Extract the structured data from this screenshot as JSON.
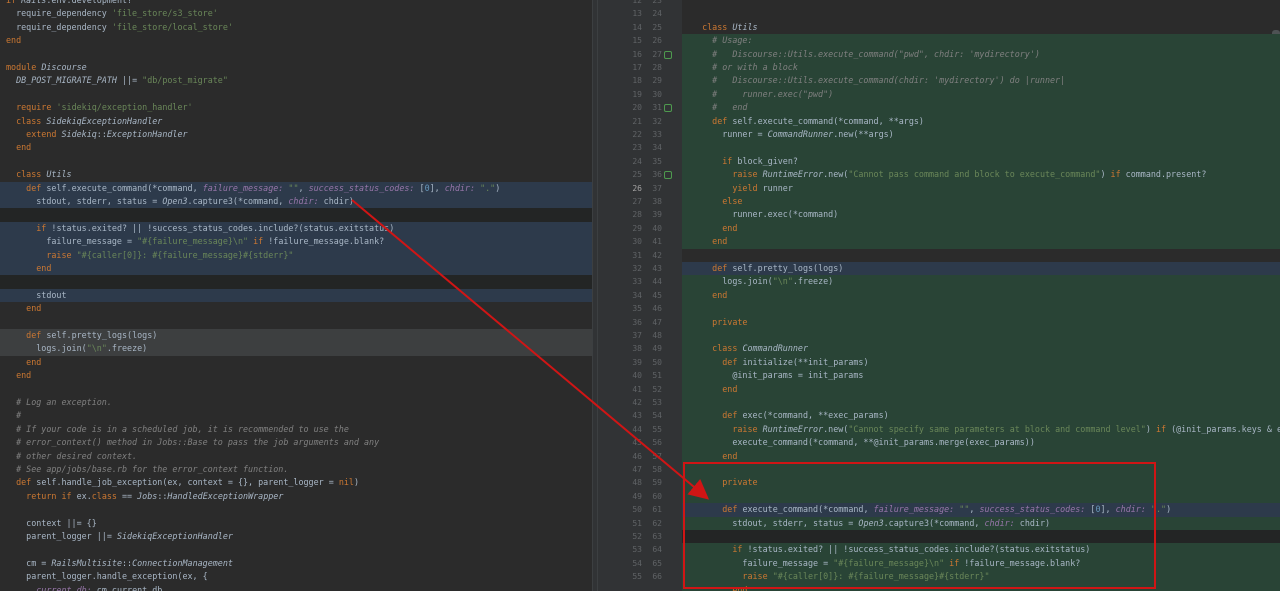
{
  "left_pane": {
    "lines": [
      {
        "t": "if Rails.env.development?",
        "cls": ""
      },
      {
        "t": "  require_dependency 'file_store/s3_store'",
        "cls": ""
      },
      {
        "t": "  require_dependency 'file_store/local_store'",
        "cls": ""
      },
      {
        "t": "end",
        "cls": ""
      },
      {
        "t": "",
        "cls": ""
      },
      {
        "t": "module Discourse",
        "cls": ""
      },
      {
        "t": "  DB_POST_MIGRATE_PATH ||= \"db/post_migrate\"",
        "cls": ""
      },
      {
        "t": "",
        "cls": ""
      },
      {
        "t": "  require 'sidekiq/exception_handler'",
        "cls": ""
      },
      {
        "t": "  class SidekiqExceptionHandler",
        "cls": ""
      },
      {
        "t": "    extend Sidekiq::ExceptionHandler",
        "cls": ""
      },
      {
        "t": "  end",
        "cls": ""
      },
      {
        "t": "",
        "cls": ""
      },
      {
        "t": "  class Utils",
        "cls": ""
      },
      {
        "t": "    def self.execute_command(*command, failure_message: \"\", success_status_codes: [0], chdir: \".\")",
        "cls": "hl-blue"
      },
      {
        "t": "      stdout, stderr, status = Open3.capture3(*command, chdir: chdir)",
        "cls": "hl-blue"
      },
      {
        "t": "",
        "cls": "hl-dark"
      },
      {
        "t": "      if !status.exited? || !success_status_codes.include?(status.exitstatus)",
        "cls": "hl-blue"
      },
      {
        "t": "        failure_message = \"#{failure_message}\\n\" if !failure_message.blank?",
        "cls": "hl-blue"
      },
      {
        "t": "        raise \"#{caller[0]}: #{failure_message}#{stderr}\"",
        "cls": "hl-blue"
      },
      {
        "t": "      end",
        "cls": "hl-blue"
      },
      {
        "t": "",
        "cls": "hl-dark"
      },
      {
        "t": "      stdout",
        "cls": "hl-blue"
      },
      {
        "t": "    end",
        "cls": ""
      },
      {
        "t": "",
        "cls": ""
      },
      {
        "t": "    def self.pretty_logs(logs)",
        "cls": "hl-grey"
      },
      {
        "t": "      logs.join(\"\\n\".freeze)",
        "cls": "hl-grey"
      },
      {
        "t": "    end",
        "cls": ""
      },
      {
        "t": "  end",
        "cls": ""
      },
      {
        "t": "",
        "cls": ""
      },
      {
        "t": "  # Log an exception.",
        "cls": ""
      },
      {
        "t": "  #",
        "cls": ""
      },
      {
        "t": "  # If your code is in a scheduled job, it is recommended to use the",
        "cls": ""
      },
      {
        "t": "  # error_context() method in Jobs::Base to pass the job arguments and any",
        "cls": ""
      },
      {
        "t": "  # other desired context.",
        "cls": ""
      },
      {
        "t": "  # See app/jobs/base.rb for the error_context function.",
        "cls": ""
      },
      {
        "t": "  def self.handle_job_exception(ex, context = {}, parent_logger = nil)",
        "cls": ""
      },
      {
        "t": "    return if ex.class == Jobs::HandledExceptionWrapper",
        "cls": ""
      },
      {
        "t": "",
        "cls": ""
      },
      {
        "t": "    context ||= {}",
        "cls": ""
      },
      {
        "t": "    parent_logger ||= SidekiqExceptionHandler",
        "cls": ""
      },
      {
        "t": "",
        "cls": ""
      },
      {
        "t": "    cm = RailsMultisite::ConnectionManagement",
        "cls": ""
      },
      {
        "t": "    parent_logger.handle_exception(ex, {",
        "cls": ""
      },
      {
        "t": "      current_db: cm.current_db,",
        "cls": ""
      }
    ]
  },
  "gutter": {
    "numbers": [
      "12",
      "13",
      "14",
      "15",
      "16",
      "17",
      "18",
      "19",
      "20",
      "21",
      "22",
      "23",
      "24",
      "25",
      "26",
      "27",
      "28",
      "29",
      "30",
      "31",
      "32",
      "33",
      "34",
      "35",
      "36",
      "37",
      "38",
      "39",
      "40",
      "41",
      "42",
      "43",
      "44",
      "45",
      "46",
      "47",
      "48",
      "49",
      "50",
      "51",
      "52",
      "53",
      "54",
      "55"
    ],
    "current": "26"
  },
  "right_pane": {
    "numbers": [
      "23",
      "24",
      "25",
      "26",
      "27",
      "28",
      "29",
      "30",
      "31",
      "32",
      "33",
      "34",
      "35",
      "36",
      "37",
      "38",
      "39",
      "40",
      "41",
      "42",
      "43",
      "44",
      "45",
      "46",
      "47",
      "48",
      "49",
      "50",
      "51",
      "52",
      "53",
      "54",
      "55",
      "56",
      "57",
      "58",
      "59",
      "60",
      "61",
      "62",
      "63",
      "64",
      "65",
      "66"
    ],
    "lines": [
      {
        "t": "",
        "cls": ""
      },
      {
        "t": "",
        "cls": ""
      },
      {
        "t": "  class Utils",
        "cls": ""
      },
      {
        "t": "    # Usage:",
        "cls": "hl-green"
      },
      {
        "t": "    #   Discourse::Utils.execute_command(\"pwd\", chdir: 'mydirectory')",
        "cls": "hl-green"
      },
      {
        "t": "    # or with a block",
        "cls": "hl-green"
      },
      {
        "t": "    #   Discourse::Utils.execute_command(chdir: 'mydirectory') do |runner|",
        "cls": "hl-green"
      },
      {
        "t": "    #     runner.exec(\"pwd\")",
        "cls": "hl-green"
      },
      {
        "t": "    #   end",
        "cls": "hl-green"
      },
      {
        "t": "    def self.execute_command(*command, **args)",
        "cls": "hl-green"
      },
      {
        "t": "      runner = CommandRunner.new(**args)",
        "cls": "hl-green"
      },
      {
        "t": "",
        "cls": "hl-green"
      },
      {
        "t": "      if block_given?",
        "cls": "hl-green"
      },
      {
        "t": "        raise RuntimeError.new(\"Cannot pass command and block to execute_command\") if command.present?",
        "cls": "hl-green"
      },
      {
        "t": "        yield runner",
        "cls": "hl-green"
      },
      {
        "t": "      else",
        "cls": "hl-green"
      },
      {
        "t": "        runner.exec(*command)",
        "cls": "hl-green"
      },
      {
        "t": "      end",
        "cls": "hl-green"
      },
      {
        "t": "    end",
        "cls": "hl-green"
      },
      {
        "t": "",
        "cls": ""
      },
      {
        "t": "    def self.pretty_logs(logs)",
        "cls": "hl-blue"
      },
      {
        "t": "      logs.join(\"\\n\".freeze)",
        "cls": "hl-green"
      },
      {
        "t": "    end",
        "cls": "hl-green"
      },
      {
        "t": "",
        "cls": "hl-green"
      },
      {
        "t": "    private",
        "cls": "hl-green"
      },
      {
        "t": "",
        "cls": "hl-green"
      },
      {
        "t": "    class CommandRunner",
        "cls": "hl-green"
      },
      {
        "t": "      def initialize(**init_params)",
        "cls": "hl-green"
      },
      {
        "t": "        @init_params = init_params",
        "cls": "hl-green"
      },
      {
        "t": "      end",
        "cls": "hl-green"
      },
      {
        "t": "",
        "cls": "hl-green"
      },
      {
        "t": "      def exec(*command, **exec_params)",
        "cls": "hl-green"
      },
      {
        "t": "        raise RuntimeError.new(\"Cannot specify same parameters at block and command level\") if (@init_params.keys & exec_params",
        "cls": "hl-green"
      },
      {
        "t": "        execute_command(*command, **@init_params.merge(exec_params))",
        "cls": "hl-green"
      },
      {
        "t": "      end",
        "cls": "hl-green"
      },
      {
        "t": "",
        "cls": "hl-green"
      },
      {
        "t": "      private",
        "cls": "hl-green"
      },
      {
        "t": "",
        "cls": "hl-green"
      },
      {
        "t": "      def execute_command(*command, failure_message: \"\", success_status_codes: [0], chdir: \".\")",
        "cls": "hl-blue"
      },
      {
        "t": "        stdout, stderr, status = Open3.capture3(*command, chdir: chdir)",
        "cls": "hl-green"
      },
      {
        "t": "",
        "cls": "hl-dark"
      },
      {
        "t": "        if !status.exited? || !success_status_codes.include?(status.exitstatus)",
        "cls": "hl-green"
      },
      {
        "t": "          failure_message = \"#{failure_message}\\n\" if !failure_message.blank?",
        "cls": "hl-green"
      },
      {
        "t": "          raise \"#{caller[0]}: #{failure_message}#{stderr}\"",
        "cls": "hl-green"
      },
      {
        "t": "        end",
        "cls": "hl-green"
      }
    ]
  },
  "colors": {
    "annotation_red": "#d01515",
    "background": "#2b2b2b",
    "diff_green": "#294436",
    "diff_blue": "#2d3a4b"
  }
}
